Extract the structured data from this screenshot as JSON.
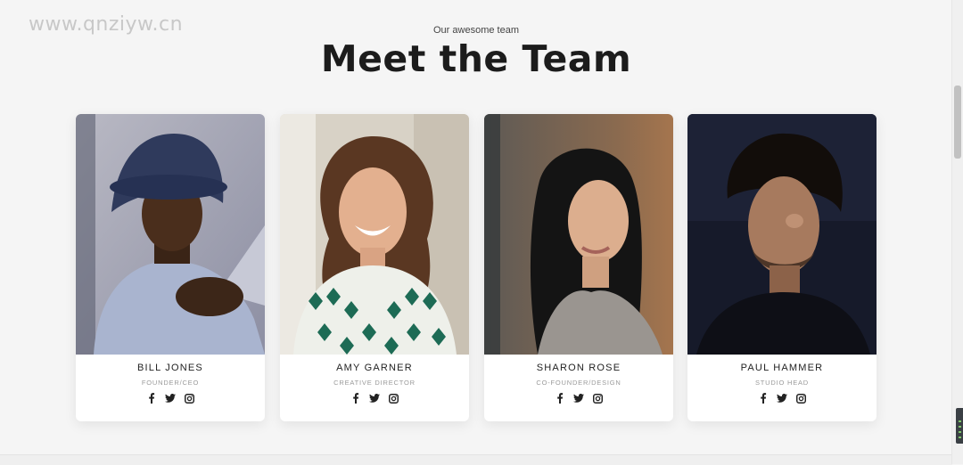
{
  "watermark": "www.qnziyw.cn",
  "header": {
    "subtitle": "Our awesome team",
    "title": "Meet the Team"
  },
  "team": [
    {
      "name": "BILL JONES",
      "role": "FOUNDER/CEO"
    },
    {
      "name": "AMY GARNER",
      "role": "CREATIVE DIRECTOR"
    },
    {
      "name": "SHARON ROSE",
      "role": "CO-FOUNDER/DESIGN"
    },
    {
      "name": "PAUL HAMMER",
      "role": "STUDIO HEAD"
    }
  ],
  "social_icons": [
    "facebook-icon",
    "twitter-icon",
    "instagram-icon"
  ],
  "colors": {
    "background": "#f5f5f5",
    "card": "#ffffff",
    "title": "#1c1c1c",
    "role": "#9a9a9a"
  }
}
